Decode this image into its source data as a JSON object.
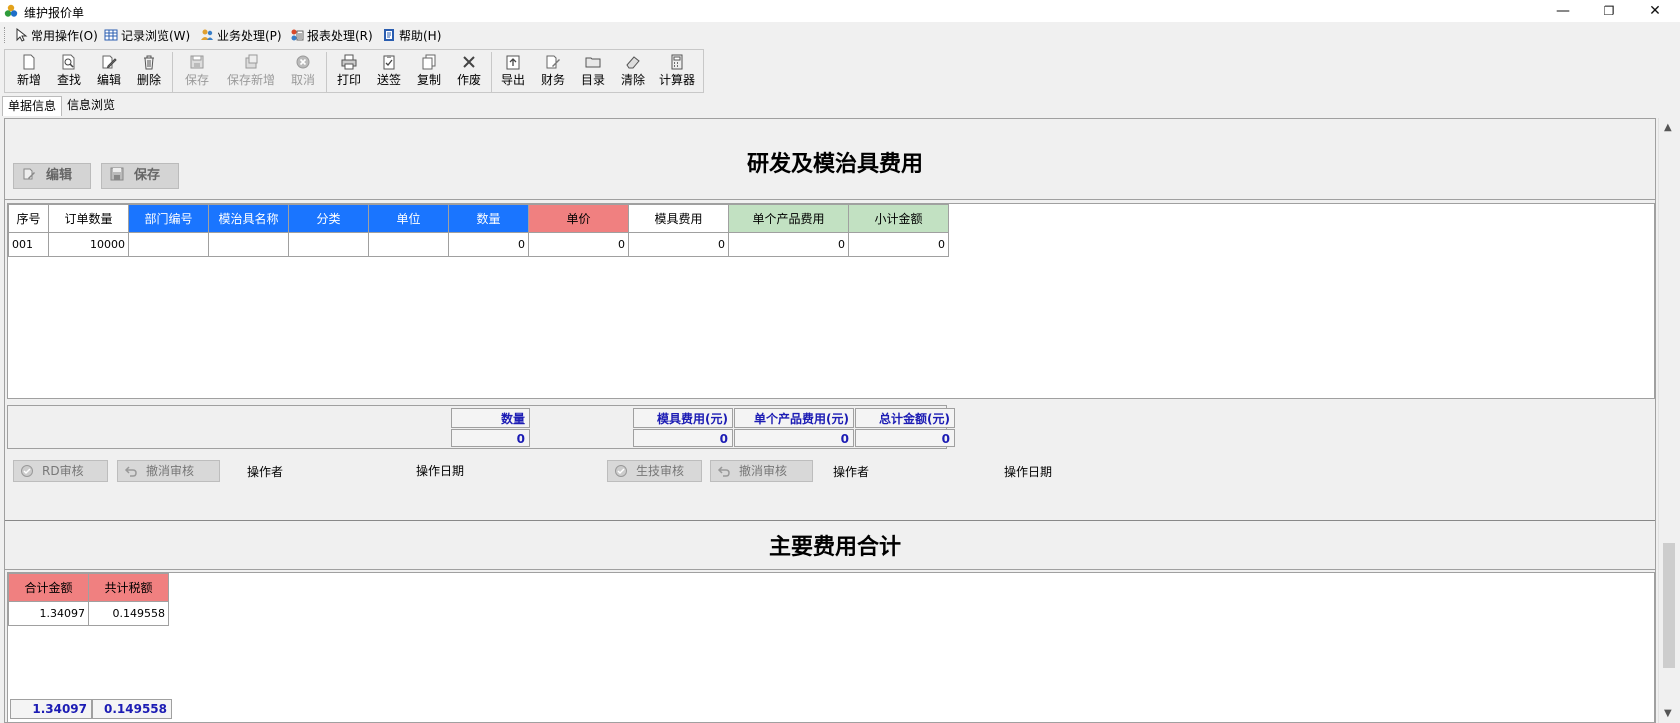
{
  "window": {
    "title": "维护报价单",
    "controls": {
      "minimize": "—",
      "restore": "❐",
      "close": "✕"
    }
  },
  "menu": {
    "items": [
      {
        "label": "常用操作(O)",
        "icon": "cursor-icon"
      },
      {
        "label": "记录浏览(W)",
        "icon": "table-icon"
      },
      {
        "label": "业务处理(P)",
        "icon": "users-icon"
      },
      {
        "label": "报表处理(R)",
        "icon": "report-icon"
      },
      {
        "label": "帮助(H)",
        "icon": "help-book-icon"
      }
    ]
  },
  "toolbar": {
    "new": "新增",
    "find": "查找",
    "edit": "编辑",
    "delete": "删除",
    "save": "保存",
    "save_new": "保存新增",
    "cancel": "取消",
    "print": "打印",
    "send_sign": "送签",
    "copy": "复制",
    "void": "作废",
    "export": "导出",
    "finance": "财务",
    "catalog": "目录",
    "clear": "清除",
    "calculator": "计算器"
  },
  "tabs": {
    "doc_info": "单据信息",
    "info_browse": "信息浏览"
  },
  "section1": {
    "title": "研发及模治具费用",
    "edit_button": "编辑",
    "save_button": "保存",
    "columns": [
      "序号",
      "订单数量",
      "部门编号",
      "模治具名称",
      "分类",
      "单位",
      "数量",
      "单价",
      "模具费用",
      "单个产品费用",
      "小计金额"
    ],
    "rows": [
      [
        "001",
        "10000",
        "",
        "",
        "",
        "",
        "0",
        "0",
        "0",
        "0",
        "0"
      ]
    ],
    "summary": {
      "qty_label": "数量",
      "qty_value": "0",
      "mold_label": "模具费用(元)",
      "mold_value": "0",
      "unit_label": "单个产品费用(元)",
      "unit_value": "0",
      "total_label": "总计金额(元)",
      "total_value": "0"
    },
    "audit": {
      "rd_audit": "RD审核",
      "rd_cancel": "撤消审核",
      "rd_operator": "操作者",
      "rd_date": "操作日期",
      "prod_audit": "生技审核",
      "prod_cancel": "撤消审核",
      "prod_operator": "操作者",
      "prod_date": "操作日期"
    }
  },
  "section2": {
    "title": "主要费用合计",
    "columns": [
      "合计金额",
      "共计税额"
    ],
    "rows": [
      [
        "1.34097",
        "0.149558"
      ]
    ],
    "totals": [
      "1.34097",
      "0.149558"
    ]
  },
  "colors": {
    "blue_header": "#1a75ff",
    "red_header": "#f08080",
    "green_header": "#c2e1c2",
    "summary_text": "#1c1cb4"
  }
}
